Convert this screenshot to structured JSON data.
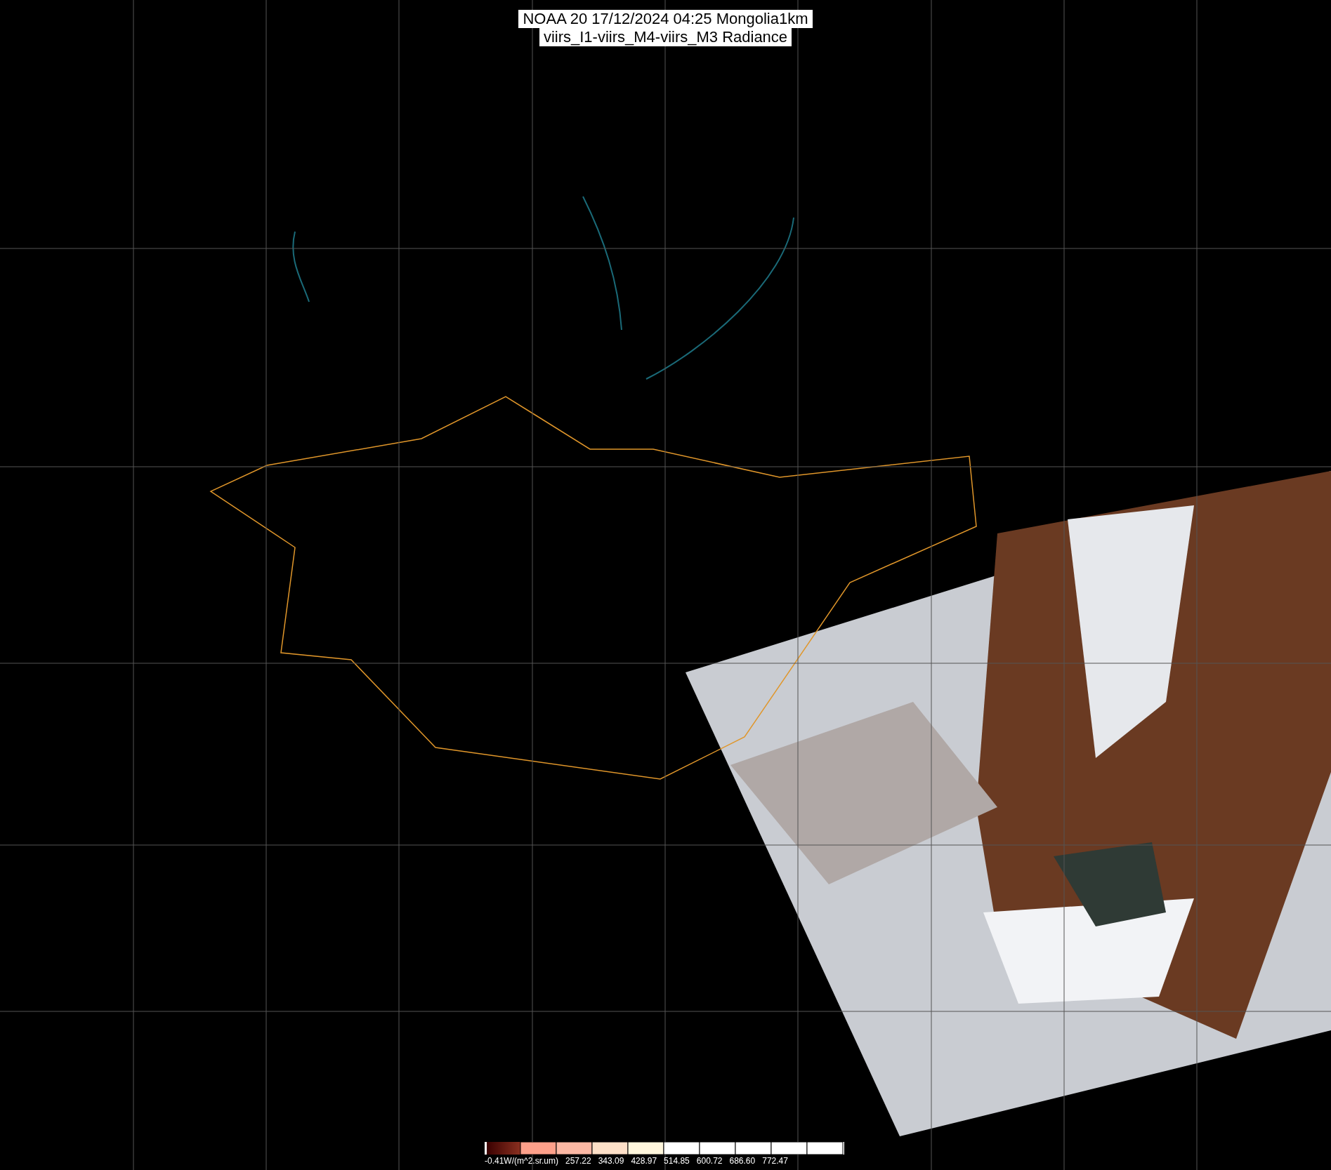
{
  "title": {
    "lines": [
      "NOAA 20 17/12/2024 04:25 Mongolia1km",
      "viirs_I1-viirs_M4-viirs_M3 Radiance"
    ]
  },
  "colorbar": {
    "labels": [
      "-0.41W/(m^2.sr.um)",
      "257.22",
      "343.09",
      "428.97",
      "514.85",
      "600.72",
      "686.60",
      "772.47"
    ]
  }
}
